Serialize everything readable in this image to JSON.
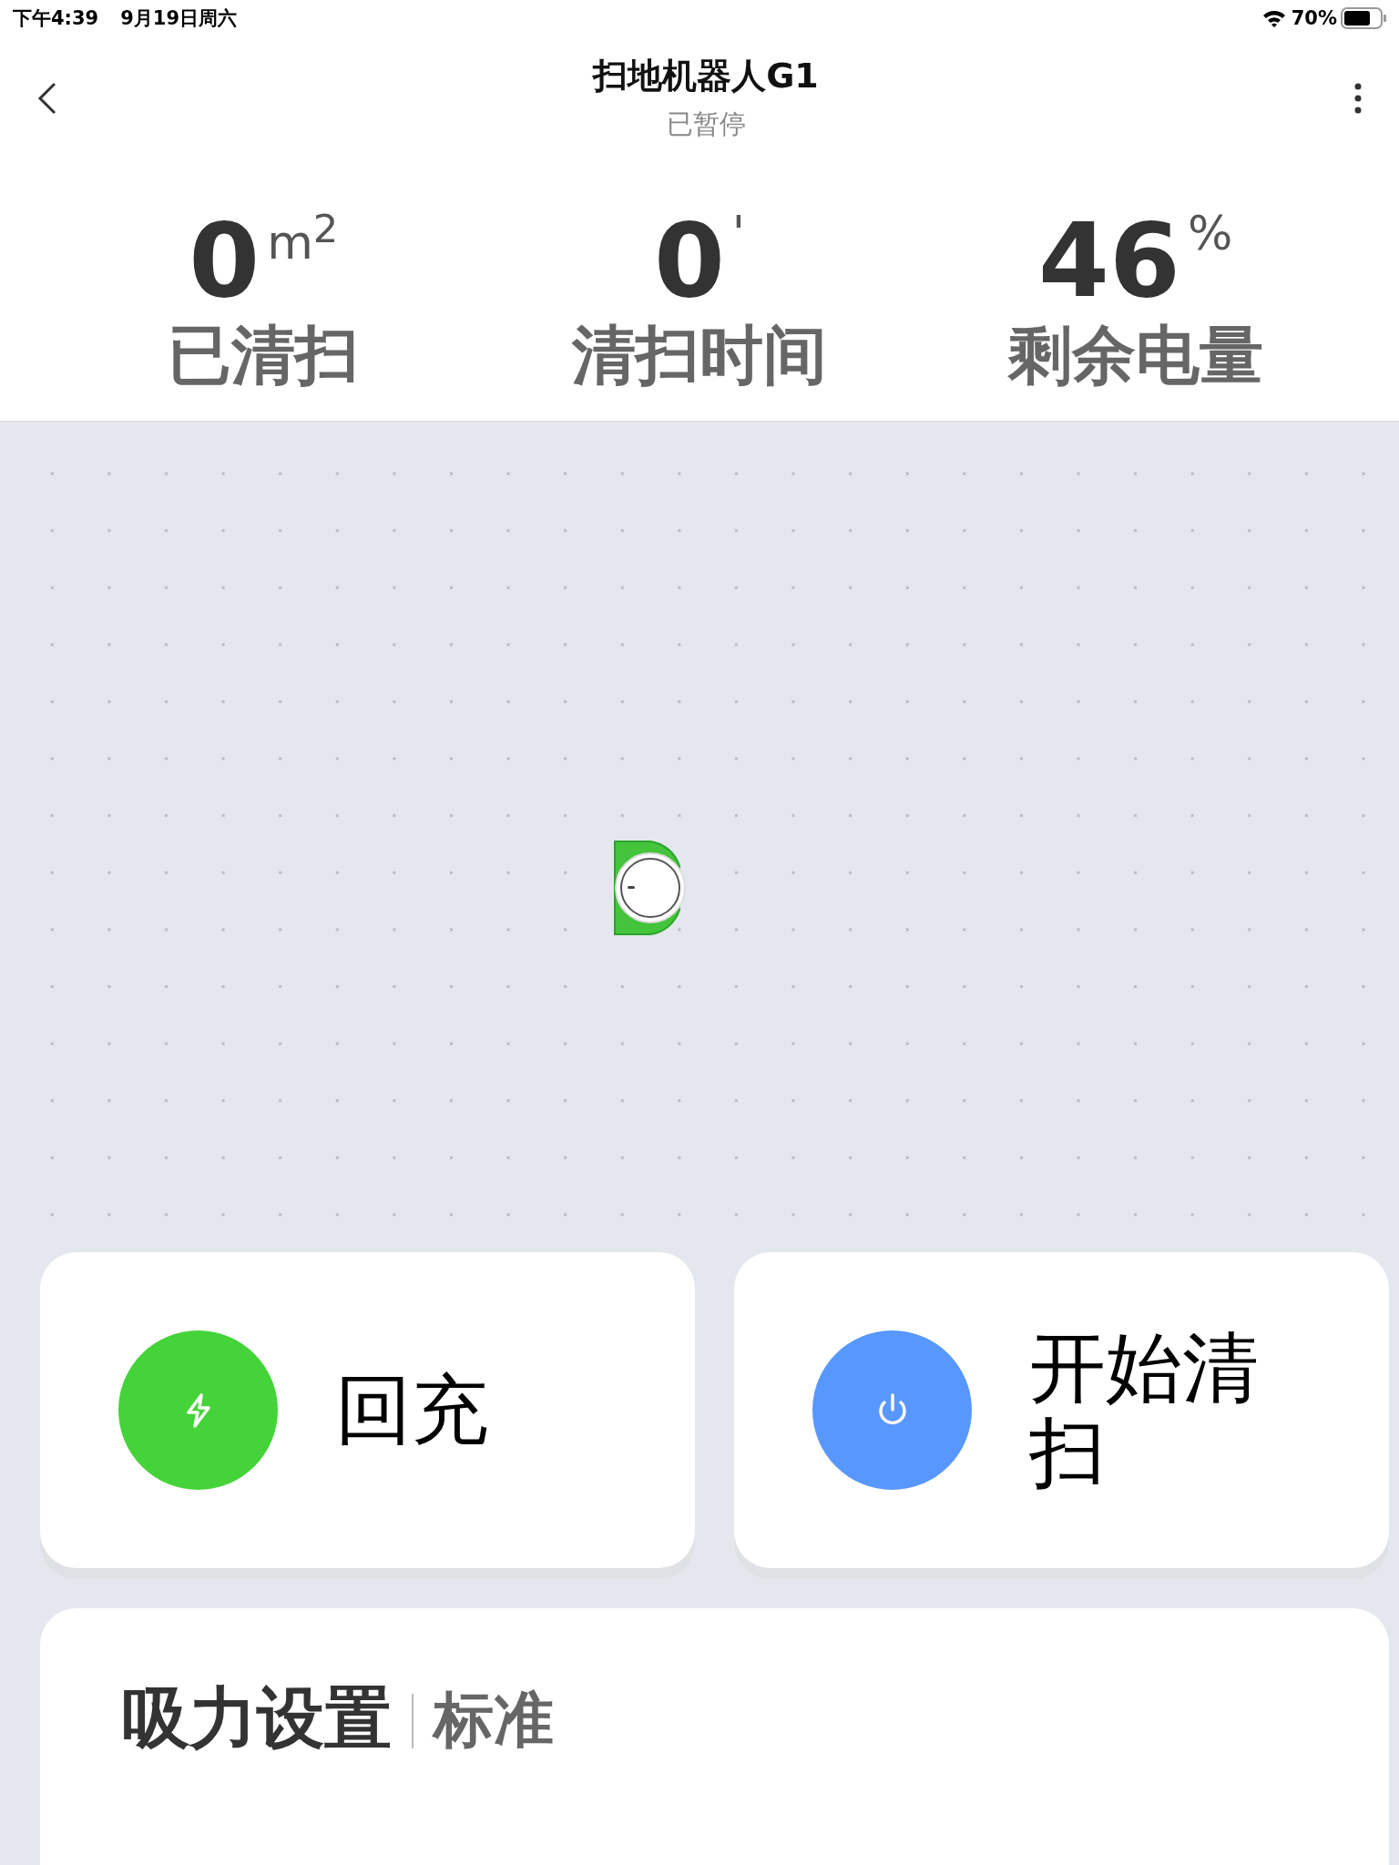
{
  "status_bar": {
    "time": "下午4:39",
    "date": "9月19日周六",
    "battery_text": "70%"
  },
  "header": {
    "title": "扫地机器人G1",
    "subtitle": "已暂停"
  },
  "stats": [
    {
      "value": "0",
      "unit": "m$^{2}$",
      "label": "已清扫"
    },
    {
      "value": "0",
      "unit": "'",
      "label": "清扫时间"
    },
    {
      "value": "46",
      "unit": "%",
      "label": "剩余电量"
    }
  ],
  "actions": [
    {
      "kind": "charge",
      "label": "回充",
      "color": "#44d339"
    },
    {
      "kind": "power",
      "label": "开始清扫",
      "color": "#5797fe"
    }
  ],
  "suction": {
    "label": "吸力设置",
    "value": "标准"
  }
}
